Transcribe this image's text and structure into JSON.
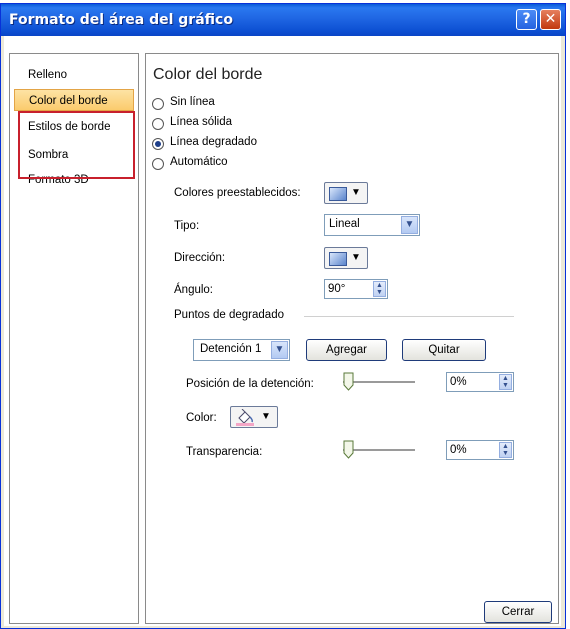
{
  "window": {
    "title": "Formato del área del gráfico",
    "help_glyph": "?",
    "close_glyph": "✕"
  },
  "nav": [
    {
      "label": "Relleno",
      "selected": false
    },
    {
      "label": "Color del borde",
      "selected": true
    },
    {
      "label": "Estilos de borde",
      "selected": false
    },
    {
      "label": "Sombra",
      "selected": false
    },
    {
      "label": "Formato 3D",
      "selected": false
    }
  ],
  "panel": {
    "heading": "Color del borde",
    "radios": [
      {
        "label": "Sin línea",
        "checked": false
      },
      {
        "label": "Línea sólida",
        "checked": false
      },
      {
        "label": "Línea degradado",
        "checked": true
      },
      {
        "label": "Automático",
        "checked": false
      }
    ],
    "preset_colors_label": "Colores preestablecidos:",
    "type_label": "Tipo:",
    "type_value": "Lineal",
    "direction_label": "Dirección:",
    "angle_label": "Ángulo:",
    "angle_value": "90°",
    "stops_label": "Puntos de degradado",
    "stop_select": "Detención 1",
    "add_button": "Agregar",
    "remove_button": "Quitar",
    "stop_position_label": "Posición de la detención:",
    "stop_position_value": "0%",
    "stop_position_fraction": 0,
    "color_label": "Color:",
    "transparency_label": "Transparencia:",
    "transparency_value": "0%",
    "transparency_fraction": 0
  },
  "footer": {
    "close_button": "Cerrar"
  },
  "colors": {
    "accent_red": "#c8202c",
    "selection": "#fbcb6d",
    "titlebar": "#0c4fd2"
  }
}
